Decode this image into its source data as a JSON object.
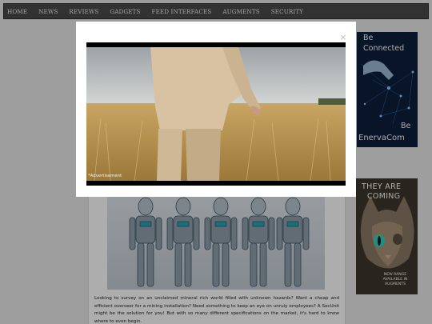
{
  "nav": {
    "items": [
      "HOME",
      "NEWS",
      "REVIEWS",
      "GADGETS",
      "FEED INTERFACES",
      "AUGMENTS",
      "SECURITY"
    ]
  },
  "article": {
    "body": "Looking to survey on an unclaimed mineral rich world filled with unknown hazards? Want a cheap and efficient overseer for a mining installation? Need something to keep an eye on unruly employees? A SecUnit might be the solution for you! But with so many different specifications on the market, it's hard to know where to even begin."
  },
  "sidebar": {
    "ad_connected": {
      "line1": "Be",
      "line2": "Connected",
      "line3": "Be",
      "brand": "EnervaCom"
    },
    "ad_coming": {
      "line1": "THEY ARE",
      "line2": "COMING",
      "fine_print": "NEW RANGE AVAILABLE IN AUGMENTS"
    }
  },
  "modal": {
    "close_symbol": "×",
    "video_label": "*Advertisement"
  },
  "colors": {
    "nav_bg": "#4a4a4a",
    "ad_blue": "#0c1e3c",
    "wheat": "#c9a564"
  }
}
